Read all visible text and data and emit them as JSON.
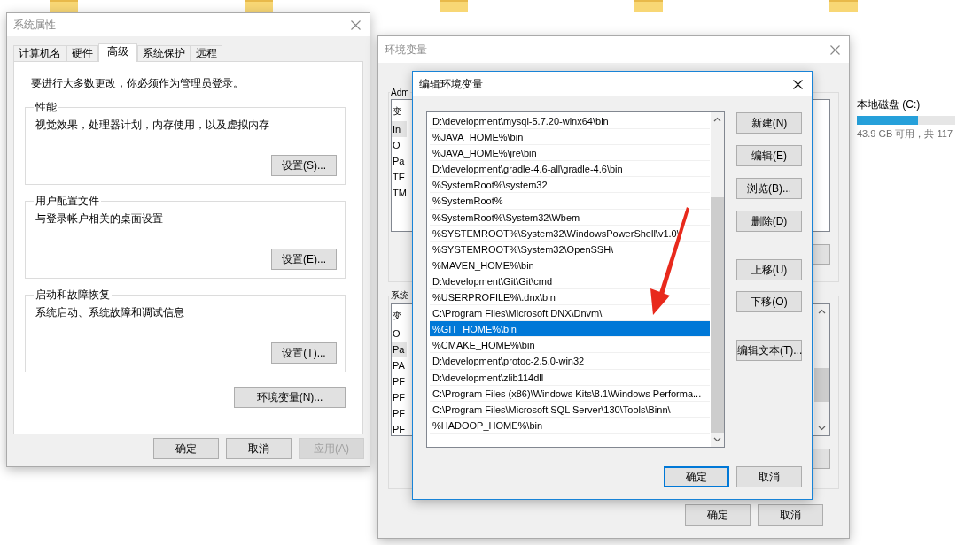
{
  "drive": {
    "name": "本地磁盘 (C:)",
    "level": 0.62,
    "free": "43.9 GB 可用，共 117"
  },
  "system_properties": {
    "title": "系统属性",
    "tabs": [
      {
        "label": "计算机名",
        "selected": false
      },
      {
        "label": "硬件",
        "selected": false
      },
      {
        "label": "高级",
        "selected": true
      },
      {
        "label": "系统保护",
        "selected": false
      },
      {
        "label": "远程",
        "selected": false
      }
    ],
    "notice": "要进行大多数更改，你必须作为管理员登录。",
    "groups": [
      {
        "title": "性能",
        "description": "视觉效果，处理器计划，内存使用，以及虚拟内存",
        "button": "设置(S)..."
      },
      {
        "title": "用户配置文件",
        "description": "与登录帐户相关的桌面设置",
        "button": "设置(E)..."
      },
      {
        "title": "启动和故障恢复",
        "description": "系统启动、系统故障和调试信息",
        "button": "设置(T)..."
      }
    ],
    "env_button": "环境变量(N)...",
    "buttons": [
      {
        "label": "确定",
        "disabled": false
      },
      {
        "label": "取消",
        "disabled": false
      },
      {
        "label": "应用(A)",
        "disabled": true
      }
    ]
  },
  "environment_variables": {
    "title": "环境变量",
    "user_group": "Adm",
    "user_header": "变",
    "user_rows": [
      {
        "text": "In",
        "selected": true
      },
      {
        "text": "O",
        "selected": false
      },
      {
        "text": "Pa",
        "selected": false
      },
      {
        "text": "TE",
        "selected": false
      },
      {
        "text": "TM",
        "selected": false
      }
    ],
    "system_group": "系统",
    "system_header": "变",
    "system_rows": [
      {
        "text": "O",
        "selected": false
      },
      {
        "text": "Pa",
        "selected": true
      },
      {
        "text": "PA",
        "selected": false
      },
      {
        "text": "PF",
        "selected": false
      },
      {
        "text": "PF",
        "selected": false
      },
      {
        "text": "PF",
        "selected": false
      },
      {
        "text": "PF",
        "selected": false
      }
    ],
    "buttons": [
      "确定",
      "取消"
    ]
  },
  "edit_dialog": {
    "title": "编辑环境变量",
    "paths": [
      {
        "text": "D:\\development\\mysql-5.7.20-winx64\\bin",
        "selected": false
      },
      {
        "text": "%JAVA_HOME%\\bin",
        "selected": false
      },
      {
        "text": "%JAVA_HOME%\\jre\\bin",
        "selected": false
      },
      {
        "text": "D:\\development\\gradle-4.6-all\\gradle-4.6\\bin",
        "selected": false
      },
      {
        "text": "%SystemRoot%\\system32",
        "selected": false
      },
      {
        "text": "%SystemRoot%",
        "selected": false
      },
      {
        "text": "%SystemRoot%\\System32\\Wbem",
        "selected": false
      },
      {
        "text": "%SYSTEMROOT%\\System32\\WindowsPowerShell\\v1.0\\",
        "selected": false
      },
      {
        "text": "%SYSTEMROOT%\\System32\\OpenSSH\\",
        "selected": false
      },
      {
        "text": "%MAVEN_HOME%\\bin",
        "selected": false
      },
      {
        "text": "D:\\development\\Git\\Git\\cmd",
        "selected": false
      },
      {
        "text": "%USERPROFILE%\\.dnx\\bin",
        "selected": false
      },
      {
        "text": "C:\\Program Files\\Microsoft DNX\\Dnvm\\",
        "selected": false
      },
      {
        "text": "%GIT_HOME%\\bin",
        "selected": true
      },
      {
        "text": "%CMAKE_HOME%\\bin",
        "selected": false
      },
      {
        "text": "D:\\development\\protoc-2.5.0-win32",
        "selected": false
      },
      {
        "text": "D:\\development\\zlib114dll",
        "selected": false
      },
      {
        "text": "C:\\Program Files (x86)\\Windows Kits\\8.1\\Windows Performa...",
        "selected": false
      },
      {
        "text": "C:\\Program Files\\Microsoft SQL Server\\130\\Tools\\Binn\\",
        "selected": false
      },
      {
        "text": "%HADOOP_HOME%\\bin",
        "selected": false
      }
    ],
    "side_buttons": [
      "新建(N)",
      "编辑(E)",
      "浏览(B)...",
      "删除(D)",
      "上移(U)",
      "下移(O)",
      "编辑文本(T)..."
    ],
    "buttons": [
      {
        "label": "确定",
        "default": true
      },
      {
        "label": "取消",
        "default": false
      }
    ]
  }
}
